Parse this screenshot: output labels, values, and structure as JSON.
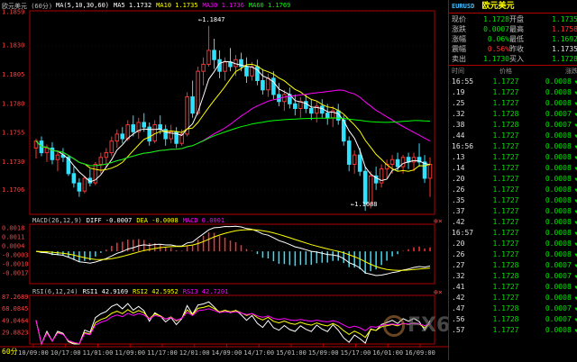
{
  "window": {
    "title": "欧元美元 (60分)",
    "period_button": "60分"
  },
  "price_legend": [
    {
      "label": "MA(5,10,30,60)",
      "color": "#ffffff"
    },
    {
      "label": "MA5  1.1732",
      "color": "#ffffff"
    },
    {
      "label": "MA10  1.1735",
      "color": "#ffff00"
    },
    {
      "label": "MA30  1.1736",
      "color": "#ff00ff"
    },
    {
      "label": "MA60  1.1769",
      "color": "#00ff00"
    }
  ],
  "macd_legend": [
    {
      "label": "MACD(26,12,9)",
      "color": "#c0c0c0"
    },
    {
      "label": "DIFF  -0.0007",
      "color": "#ffffff"
    },
    {
      "label": "DEA  -0.0008",
      "color": "#ffff00"
    },
    {
      "label": "MACD  0.0001",
      "color": "#ff00ff"
    }
  ],
  "rsi_legend": [
    {
      "label": "RSI(6,12,24)",
      "color": "#c0c0c0"
    },
    {
      "label": "RSI1  42.9169",
      "color": "#ffffff"
    },
    {
      "label": "RSI2  42.5952",
      "color": "#ffff00"
    },
    {
      "label": "RSI3  42.7201",
      "color": "#ff00ff"
    }
  ],
  "annotations": {
    "high": "1.1847",
    "low": "1.1688"
  },
  "watermark": "FX678 汇通网",
  "quote": {
    "symbol": "EURUSD",
    "name": "欧元美元",
    "rows": [
      {
        "l1": "现价",
        "v1": "1.1728",
        "c1": "g",
        "l2": "开盘",
        "v2": "1.1735",
        "c2": "g"
      },
      {
        "l1": "涨跌",
        "v1": "0.0007",
        "c1": "g",
        "l2": "最高",
        "v2": "1.1758",
        "c2": "r"
      },
      {
        "l1": "涨幅",
        "v1": "0.06%",
        "c1": "g",
        "l2": "最低",
        "v2": "1.1692",
        "c2": "g"
      },
      {
        "l1": "震幅",
        "v1": "0.56%",
        "c1": "r",
        "l2": "昨收",
        "v2": "1.1735",
        "c2": "w"
      },
      {
        "l1": "卖出",
        "v1": "1.1730",
        "c1": "g",
        "l2": "买入",
        "v2": "1.1728",
        "c2": "g"
      }
    ]
  },
  "ticks_header": {
    "time": "时间",
    "price": "价格",
    "change": "涨跌"
  },
  "ticks": [
    {
      "t": "16:55",
      "p": "1.1727",
      "c": "0.0008"
    },
    {
      "t": ".19",
      "p": "1.1727",
      "c": "0.0008"
    },
    {
      "t": ".25",
      "p": "1.1727",
      "c": "0.0008"
    },
    {
      "t": ".32",
      "p": "1.1728",
      "c": "0.0007"
    },
    {
      "t": ".38",
      "p": "1.1728",
      "c": "0.0007"
    },
    {
      "t": ".44",
      "p": "1.1727",
      "c": "0.0008"
    },
    {
      "t": "16:56",
      "p": "1.1727",
      "c": "0.0008"
    },
    {
      "t": ".13",
      "p": "1.1727",
      "c": "0.0008"
    },
    {
      "t": ".14",
      "p": "1.1727",
      "c": "0.0008"
    },
    {
      "t": ".20",
      "p": "1.1727",
      "c": "0.0008"
    },
    {
      "t": ".26",
      "p": "1.1727",
      "c": "0.0008"
    },
    {
      "t": ".35",
      "p": "1.1727",
      "c": "0.0008"
    },
    {
      "t": ".37",
      "p": "1.1727",
      "c": "0.0008"
    },
    {
      "t": ".42",
      "p": "1.1727",
      "c": "0.0008"
    },
    {
      "t": "16:57",
      "p": "1.1727",
      "c": "0.0008"
    },
    {
      "t": ".20",
      "p": "1.1727",
      "c": "0.0008"
    },
    {
      "t": ".26",
      "p": "1.1727",
      "c": "0.0008"
    },
    {
      "t": ".27",
      "p": "1.1728",
      "c": "0.0007"
    },
    {
      "t": ".32",
      "p": "1.1728",
      "c": "0.0007"
    },
    {
      "t": ".41",
      "p": "1.1727",
      "c": "0.0008"
    },
    {
      "t": ".42",
      "p": "1.1727",
      "c": "0.0008"
    },
    {
      "t": ".47",
      "p": "1.1728",
      "c": "0.0007"
    },
    {
      "t": ".56",
      "p": "1.1728",
      "c": "0.0007"
    },
    {
      "t": ".57",
      "p": "1.1727",
      "c": "0.0008"
    }
  ],
  "chart_data": {
    "type": "candlestick",
    "x_tick_labels": [
      "10/09:00",
      "10/17:00",
      "11/01:00",
      "11/09:00",
      "11/17:00",
      "12/01:00",
      "14/09:00",
      "14/17:00",
      "15/01:00",
      "15/09:00",
      "15/17:00",
      "16/01:00",
      "16/09:00"
    ],
    "price_axis": {
      "ylim": [
        1.1685,
        1.186
      ],
      "ticks": [
        "1.1859",
        "1.1830",
        "1.1805",
        "1.1780",
        "1.1755",
        "1.1730",
        "1.1706"
      ]
    },
    "macd_axis": {
      "ylim": [
        -0.0025,
        0.0021
      ],
      "ticks": [
        "0.0018",
        "0.0011",
        "0.0004",
        "-0.0003",
        "-0.0010",
        "-0.0017"
      ]
    },
    "rsi_axis": {
      "ylim": [
        12,
        90
      ],
      "ticks": [
        "87.2689",
        "68.0845",
        "49.0464",
        "29.8823"
      ]
    },
    "candles": [
      [
        1.1742,
        1.175,
        1.1733,
        1.1748
      ],
      [
        1.1748,
        1.1752,
        1.1735,
        1.1738
      ],
      [
        1.1738,
        1.1745,
        1.173,
        1.1742
      ],
      [
        1.1742,
        1.1747,
        1.1728,
        1.1732
      ],
      [
        1.1732,
        1.174,
        1.1722,
        1.1736
      ],
      [
        1.1736,
        1.1742,
        1.173,
        1.1734
      ],
      [
        1.1734,
        1.1736,
        1.1718,
        1.172
      ],
      [
        1.172,
        1.1726,
        1.1708,
        1.1712
      ],
      [
        1.1712,
        1.1716,
        1.17,
        1.1705
      ],
      [
        1.1705,
        1.1718,
        1.1703,
        1.1716
      ],
      [
        1.1716,
        1.1724,
        1.1709,
        1.1712
      ],
      [
        1.1712,
        1.173,
        1.171,
        1.1728
      ],
      [
        1.1728,
        1.1738,
        1.172,
        1.1734
      ],
      [
        1.1734,
        1.1742,
        1.1726,
        1.1738
      ],
      [
        1.1738,
        1.1752,
        1.1735,
        1.1748
      ],
      [
        1.1748,
        1.1758,
        1.1742,
        1.1754
      ],
      [
        1.1754,
        1.176,
        1.1746,
        1.175
      ],
      [
        1.175,
        1.1766,
        1.1748,
        1.1762
      ],
      [
        1.1762,
        1.177,
        1.1752,
        1.1756
      ],
      [
        1.1756,
        1.1768,
        1.175,
        1.1764
      ],
      [
        1.1764,
        1.1772,
        1.1756,
        1.176
      ],
      [
        1.176,
        1.1764,
        1.1744,
        1.1748
      ],
      [
        1.1748,
        1.1766,
        1.1746,
        1.1762
      ],
      [
        1.1762,
        1.177,
        1.1754,
        1.1758
      ],
      [
        1.1758,
        1.1762,
        1.1744,
        1.175
      ],
      [
        1.175,
        1.1762,
        1.1746,
        1.1756
      ],
      [
        1.1756,
        1.176,
        1.1742,
        1.1746
      ],
      [
        1.1746,
        1.1758,
        1.1744,
        1.1754
      ],
      [
        1.1754,
        1.179,
        1.1752,
        1.1786
      ],
      [
        1.1786,
        1.18,
        1.1768,
        1.1772
      ],
      [
        1.1772,
        1.1812,
        1.177,
        1.1808
      ],
      [
        1.1808,
        1.182,
        1.1796,
        1.1814
      ],
      [
        1.1814,
        1.1847,
        1.1812,
        1.1826
      ],
      [
        1.1826,
        1.1836,
        1.181,
        1.1818
      ],
      [
        1.1818,
        1.1826,
        1.1802,
        1.1808
      ],
      [
        1.1808,
        1.182,
        1.18,
        1.1816
      ],
      [
        1.1816,
        1.1828,
        1.1808,
        1.1812
      ],
      [
        1.1812,
        1.1822,
        1.1804,
        1.1818
      ],
      [
        1.1818,
        1.1824,
        1.1808,
        1.1812
      ],
      [
        1.1812,
        1.182,
        1.1798,
        1.1804
      ],
      [
        1.1804,
        1.1816,
        1.18,
        1.1812
      ],
      [
        1.1812,
        1.1818,
        1.1796,
        1.18
      ],
      [
        1.18,
        1.181,
        1.1788,
        1.1792
      ],
      [
        1.1792,
        1.1806,
        1.1786,
        1.1802
      ],
      [
        1.1802,
        1.1808,
        1.1784,
        1.1788
      ],
      [
        1.1788,
        1.1798,
        1.1778,
        1.1782
      ],
      [
        1.1782,
        1.1792,
        1.1774,
        1.1788
      ],
      [
        1.1788,
        1.1794,
        1.1776,
        1.178
      ],
      [
        1.178,
        1.1788,
        1.177,
        1.1776
      ],
      [
        1.1776,
        1.1786,
        1.1768,
        1.1782
      ],
      [
        1.1782,
        1.1788,
        1.1772,
        1.1776
      ],
      [
        1.1776,
        1.1784,
        1.1766,
        1.1772
      ],
      [
        1.1772,
        1.1782,
        1.1764,
        1.1778
      ],
      [
        1.1778,
        1.1784,
        1.1768,
        1.1772
      ],
      [
        1.1772,
        1.178,
        1.1762,
        1.1768
      ],
      [
        1.1768,
        1.1778,
        1.176,
        1.1774
      ],
      [
        1.1774,
        1.178,
        1.1762,
        1.1766
      ],
      [
        1.1766,
        1.177,
        1.1744,
        1.1748
      ],
      [
        1.1748,
        1.1752,
        1.1722,
        1.1728
      ],
      [
        1.1728,
        1.174,
        1.172,
        1.1736
      ],
      [
        1.1736,
        1.1742,
        1.1718,
        1.1722
      ],
      [
        1.1722,
        1.1726,
        1.1688,
        1.1694
      ],
      [
        1.1694,
        1.1722,
        1.169,
        1.1718
      ],
      [
        1.1718,
        1.1726,
        1.1706,
        1.1712
      ],
      [
        1.1712,
        1.1728,
        1.1708,
        1.1724
      ],
      [
        1.1724,
        1.1732,
        1.1716,
        1.1728
      ],
      [
        1.1728,
        1.1736,
        1.172,
        1.1732
      ],
      [
        1.1732,
        1.1738,
        1.1722,
        1.1726
      ],
      [
        1.1726,
        1.1736,
        1.172,
        1.1734
      ],
      [
        1.1734,
        1.1738,
        1.1724,
        1.173
      ],
      [
        1.173,
        1.1738,
        1.1722,
        1.1734
      ],
      [
        1.1734,
        1.1746,
        1.1726,
        1.173
      ],
      [
        1.173,
        1.1736,
        1.1712,
        1.1716
      ],
      [
        1.1716,
        1.1734,
        1.17,
        1.1728
      ]
    ],
    "ma_series": [
      {
        "name": "MA5",
        "color": "#ffffff",
        "period": 5
      },
      {
        "name": "MA10",
        "color": "#ffff00",
        "period": 10
      },
      {
        "name": "MA30",
        "color": "#ff00ff",
        "period": 30
      },
      {
        "name": "MA60",
        "color": "#00ff00",
        "period": 60
      }
    ],
    "colors": {
      "up": "#ff3030",
      "down": "#30e0ff",
      "axis": "#b00000",
      "grid": "#3a0000",
      "tick": "#ff4040",
      "xtick": "#c0c0c0"
    }
  }
}
